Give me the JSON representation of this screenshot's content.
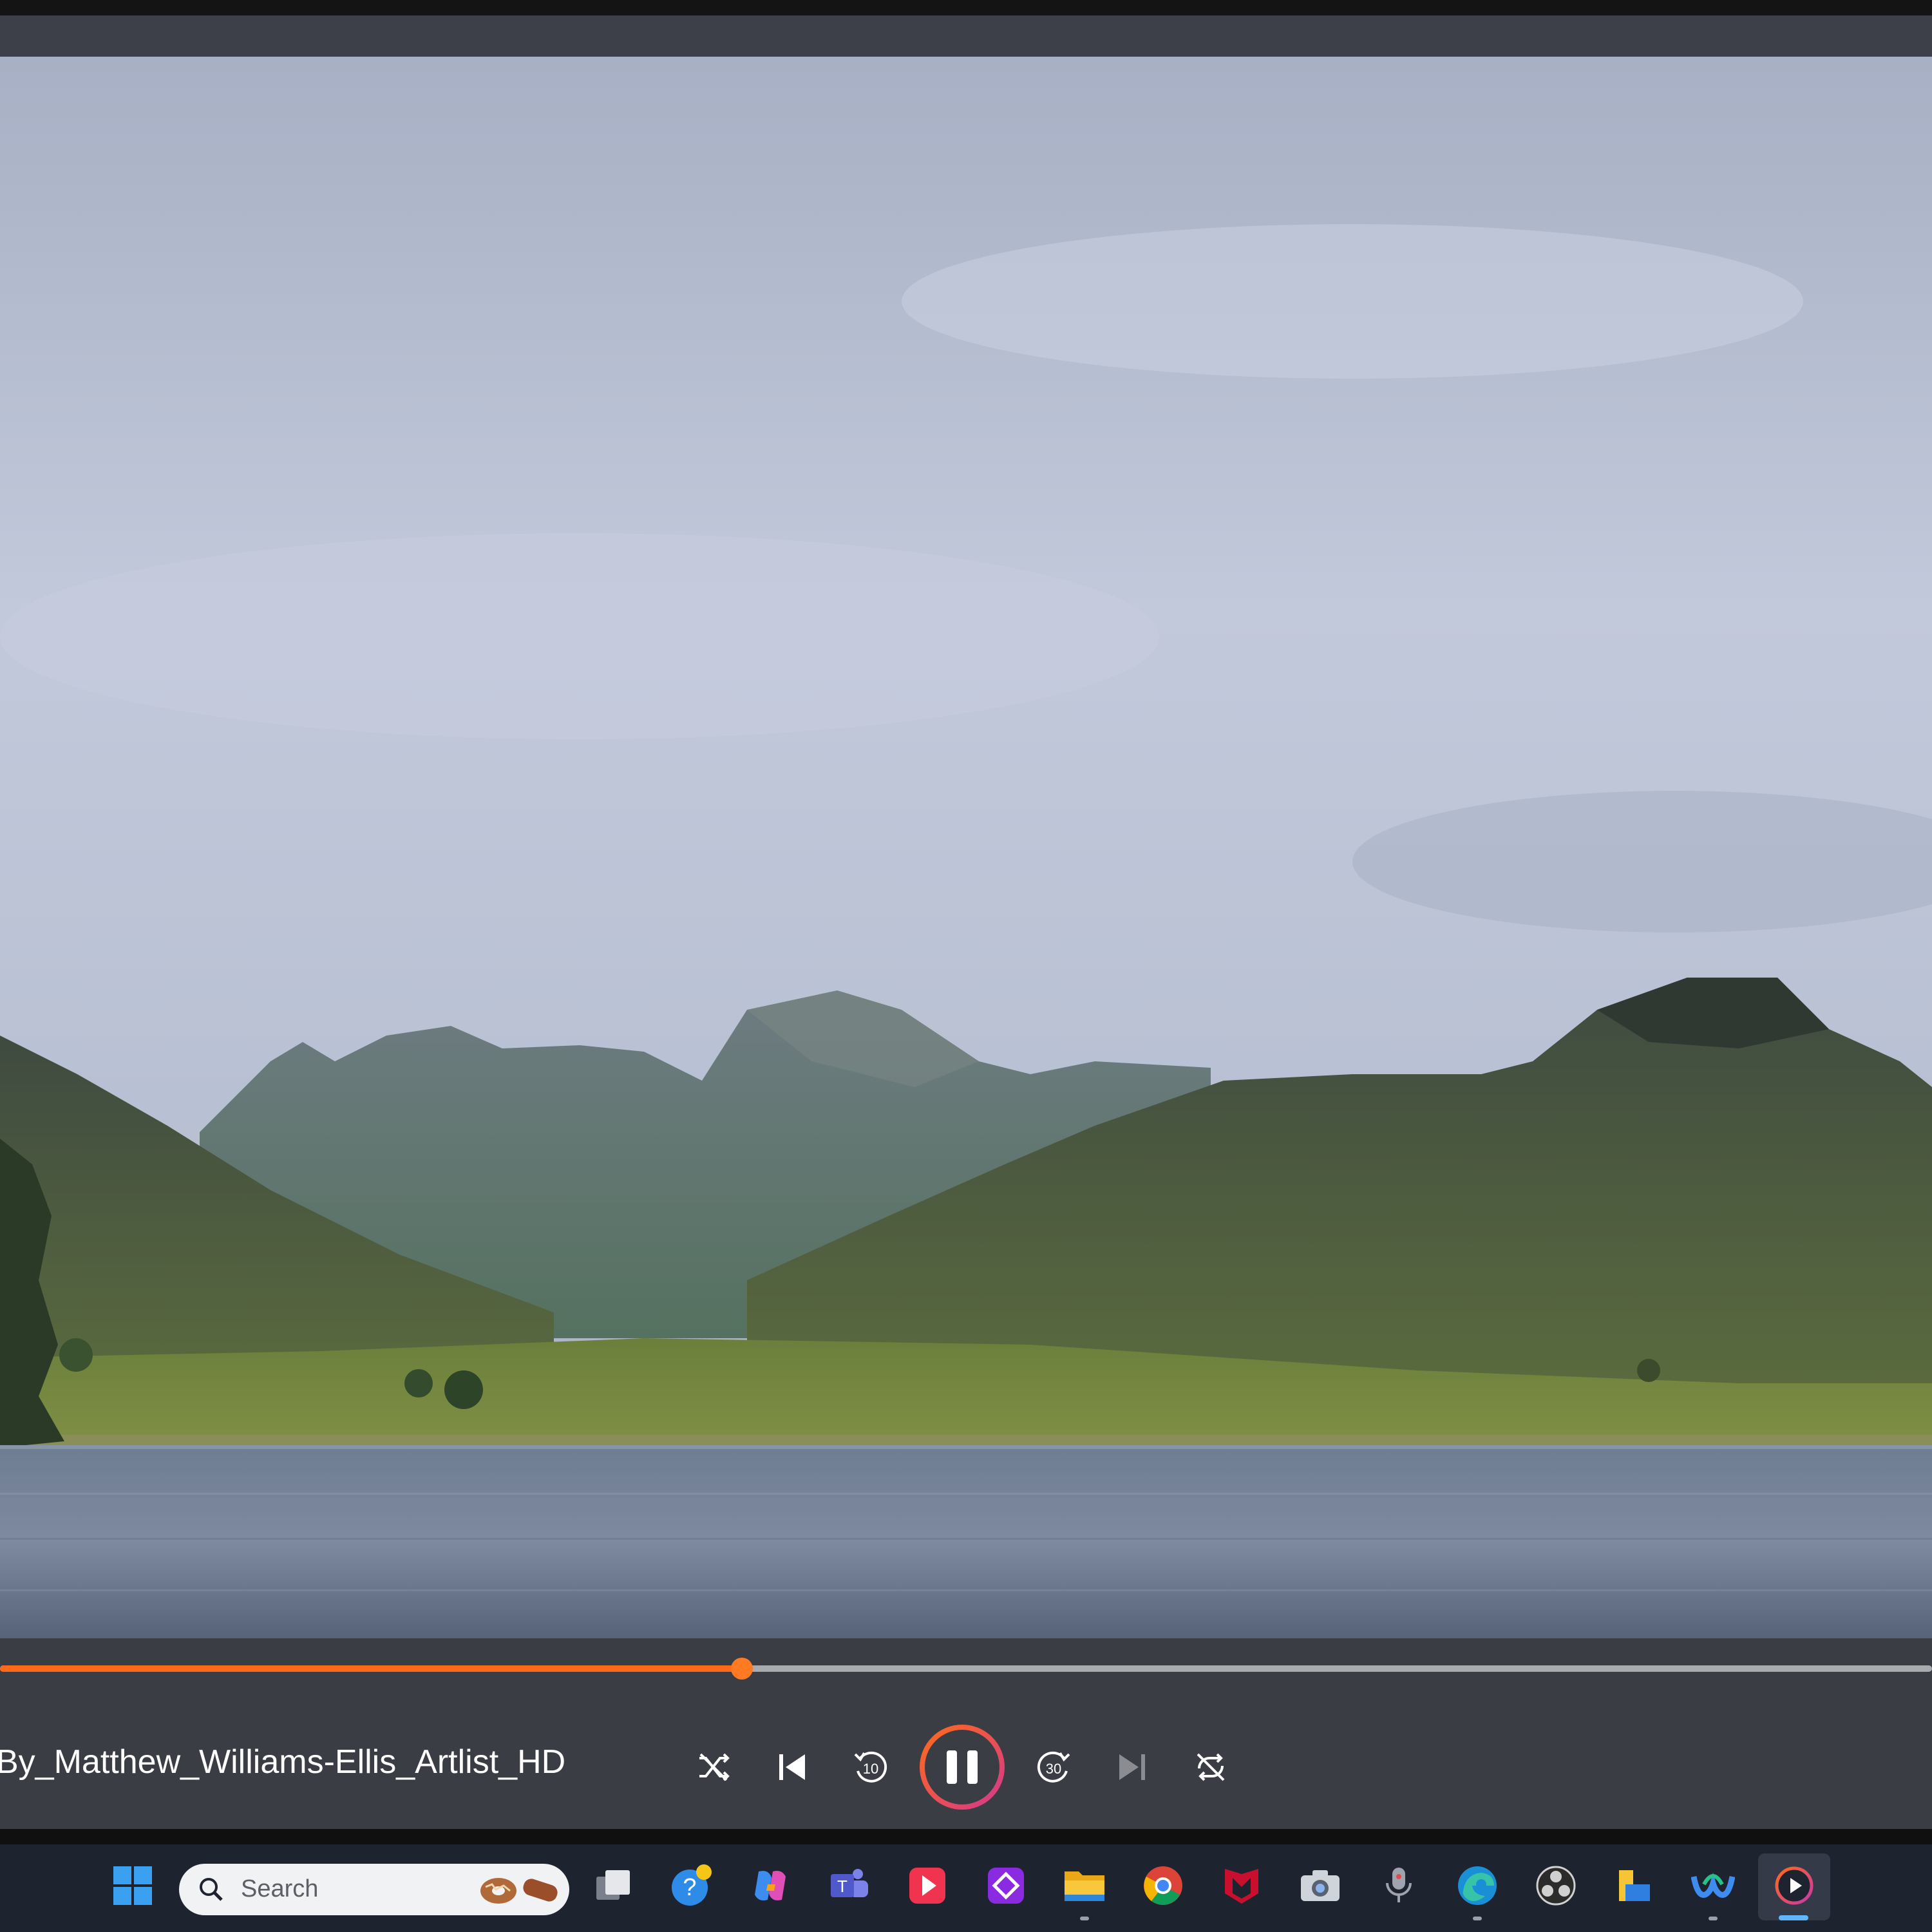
{
  "player": {
    "media_title": "By_Matthew_Williams-Ellis_Artlist_HD",
    "progress_fraction": 0.384,
    "accent_color": "#ff6a1a",
    "state": "playing",
    "controls": [
      {
        "name": "shuffle-icon"
      },
      {
        "name": "previous-icon"
      },
      {
        "name": "skip-back-10-icon",
        "label": "10"
      },
      {
        "name": "pause-icon"
      },
      {
        "name": "skip-forward-30-icon",
        "label": "30"
      },
      {
        "name": "next-icon"
      },
      {
        "name": "repeat-off-icon"
      }
    ]
  },
  "taskbar": {
    "search_placeholder": "Search",
    "icons": [
      "windows-start-icon",
      "search-icon",
      "task-view-icon",
      "get-help-icon",
      "copilot-icon",
      "teams-icon",
      "media-app-icon",
      "clipchamp-icon",
      "file-explorer-icon",
      "chrome-icon",
      "mcafee-icon",
      "camera-icon",
      "voice-recorder-icon",
      "edge-icon",
      "obs-icon",
      "files-icon",
      "webex-icon",
      "media-player-icon"
    ],
    "active_app": "media-player-icon"
  }
}
